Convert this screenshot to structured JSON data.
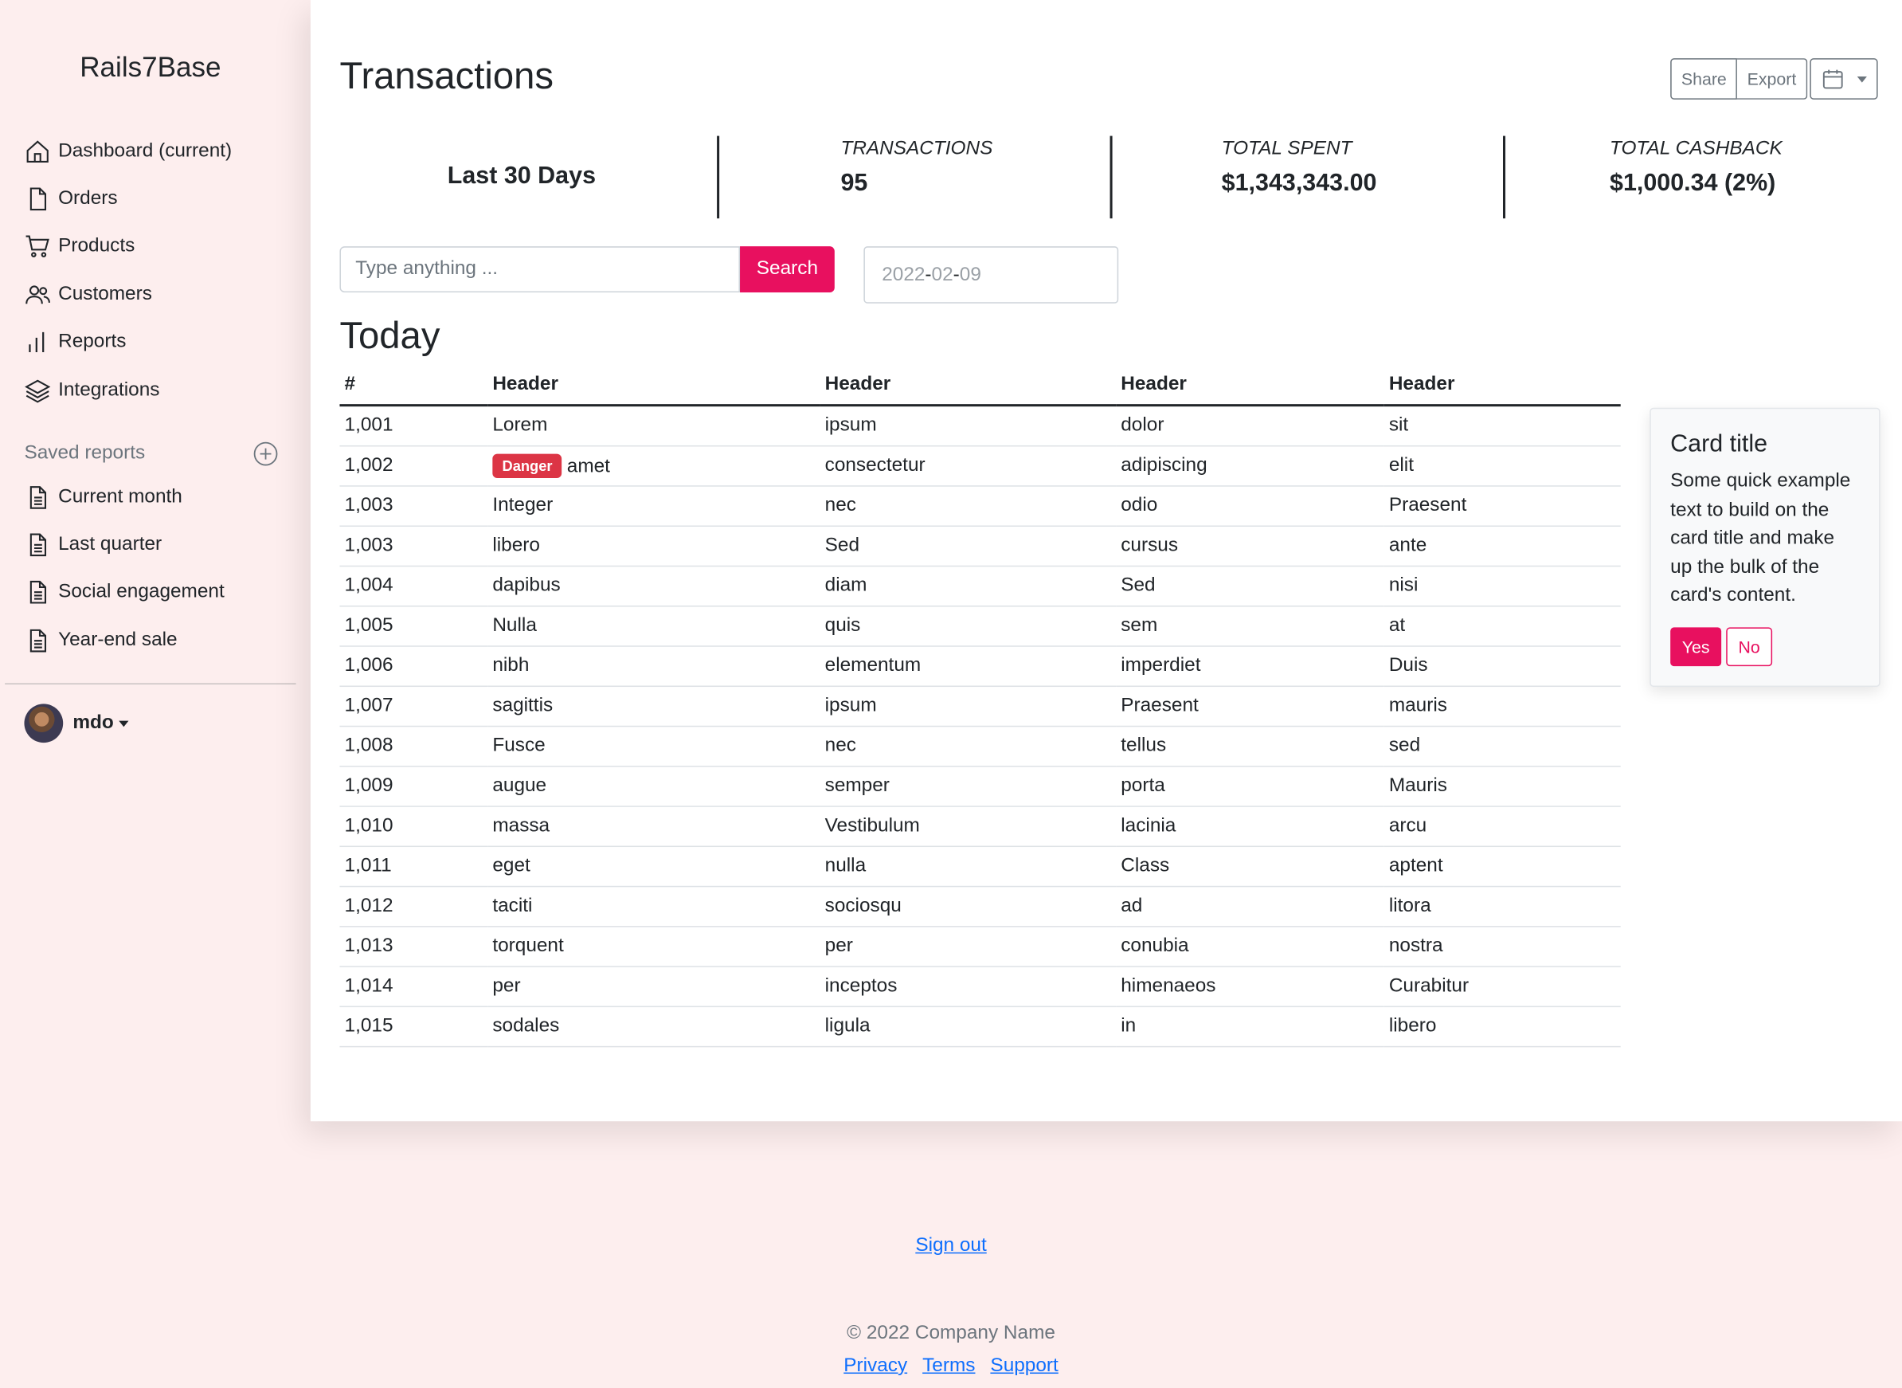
{
  "brand": "Rails7Base",
  "nav": [
    {
      "label": "Dashboard (current)",
      "icon": "home-icon"
    },
    {
      "label": "Orders",
      "icon": "file-icon"
    },
    {
      "label": "Products",
      "icon": "cart-icon"
    },
    {
      "label": "Customers",
      "icon": "people-icon"
    },
    {
      "label": "Reports",
      "icon": "bar-chart-icon"
    },
    {
      "label": "Integrations",
      "icon": "layers-icon"
    }
  ],
  "saved_reports": {
    "heading": "Saved reports",
    "items": [
      "Current month",
      "Last quarter",
      "Social engagement",
      "Year-end sale"
    ]
  },
  "user": {
    "name": "mdo"
  },
  "page": {
    "title": "Transactions",
    "actions": {
      "share": "Share",
      "export": "Export"
    }
  },
  "stats": {
    "period": "Last 30 Days",
    "transactions_label": "TRANSACTIONS",
    "transactions_value": "95",
    "spent_label": "TOTAL SPENT",
    "spent_value": "$1,343,343.00",
    "cashback_label": "TOTAL CASHBACK",
    "cashback_value": "$1,000.34 (2%)"
  },
  "search": {
    "placeholder": "Type anything ...",
    "button": "Search"
  },
  "date": {
    "year": "2022",
    "month": "02",
    "day": "09",
    "sep": "-"
  },
  "section": "Today",
  "table": {
    "headers": [
      "#",
      "Header",
      "Header",
      "Header",
      "Header"
    ],
    "rows": [
      [
        "1,001",
        "Lorem",
        "ipsum",
        "dolor",
        "sit"
      ],
      [
        "1,002",
        "amet",
        "consectetur",
        "adipiscing",
        "elit"
      ],
      [
        "1,003",
        "Integer",
        "nec",
        "odio",
        "Praesent"
      ],
      [
        "1,003",
        "libero",
        "Sed",
        "cursus",
        "ante"
      ],
      [
        "1,004",
        "dapibus",
        "diam",
        "Sed",
        "nisi"
      ],
      [
        "1,005",
        "Nulla",
        "quis",
        "sem",
        "at"
      ],
      [
        "1,006",
        "nibh",
        "elementum",
        "imperdiet",
        "Duis"
      ],
      [
        "1,007",
        "sagittis",
        "ipsum",
        "Praesent",
        "mauris"
      ],
      [
        "1,008",
        "Fusce",
        "nec",
        "tellus",
        "sed"
      ],
      [
        "1,009",
        "augue",
        "semper",
        "porta",
        "Mauris"
      ],
      [
        "1,010",
        "massa",
        "Vestibulum",
        "lacinia",
        "arcu"
      ],
      [
        "1,011",
        "eget",
        "nulla",
        "Class",
        "aptent"
      ],
      [
        "1,012",
        "taciti",
        "sociosqu",
        "ad",
        "litora"
      ],
      [
        "1,013",
        "torquent",
        "per",
        "conubia",
        "nostra"
      ],
      [
        "1,014",
        "per",
        "inceptos",
        "himenaeos",
        "Curabitur"
      ],
      [
        "1,015",
        "sodales",
        "ligula",
        "in",
        "libero"
      ]
    ],
    "badge": {
      "row": 1,
      "label": "Danger",
      "color": "#dc3545"
    }
  },
  "card": {
    "title": "Card title",
    "text": "Some quick example text to build on the card title and make up the bulk of the card's content.",
    "yes": "Yes",
    "no": "No"
  },
  "footer": {
    "signout": "Sign out",
    "copyright": "© 2022 Company Name",
    "links": [
      "Privacy",
      "Terms",
      "Support"
    ]
  },
  "colors": {
    "accent": "#e8105f",
    "background": "#fdeeee",
    "link": "#0d6efd",
    "danger": "#dc3545"
  }
}
